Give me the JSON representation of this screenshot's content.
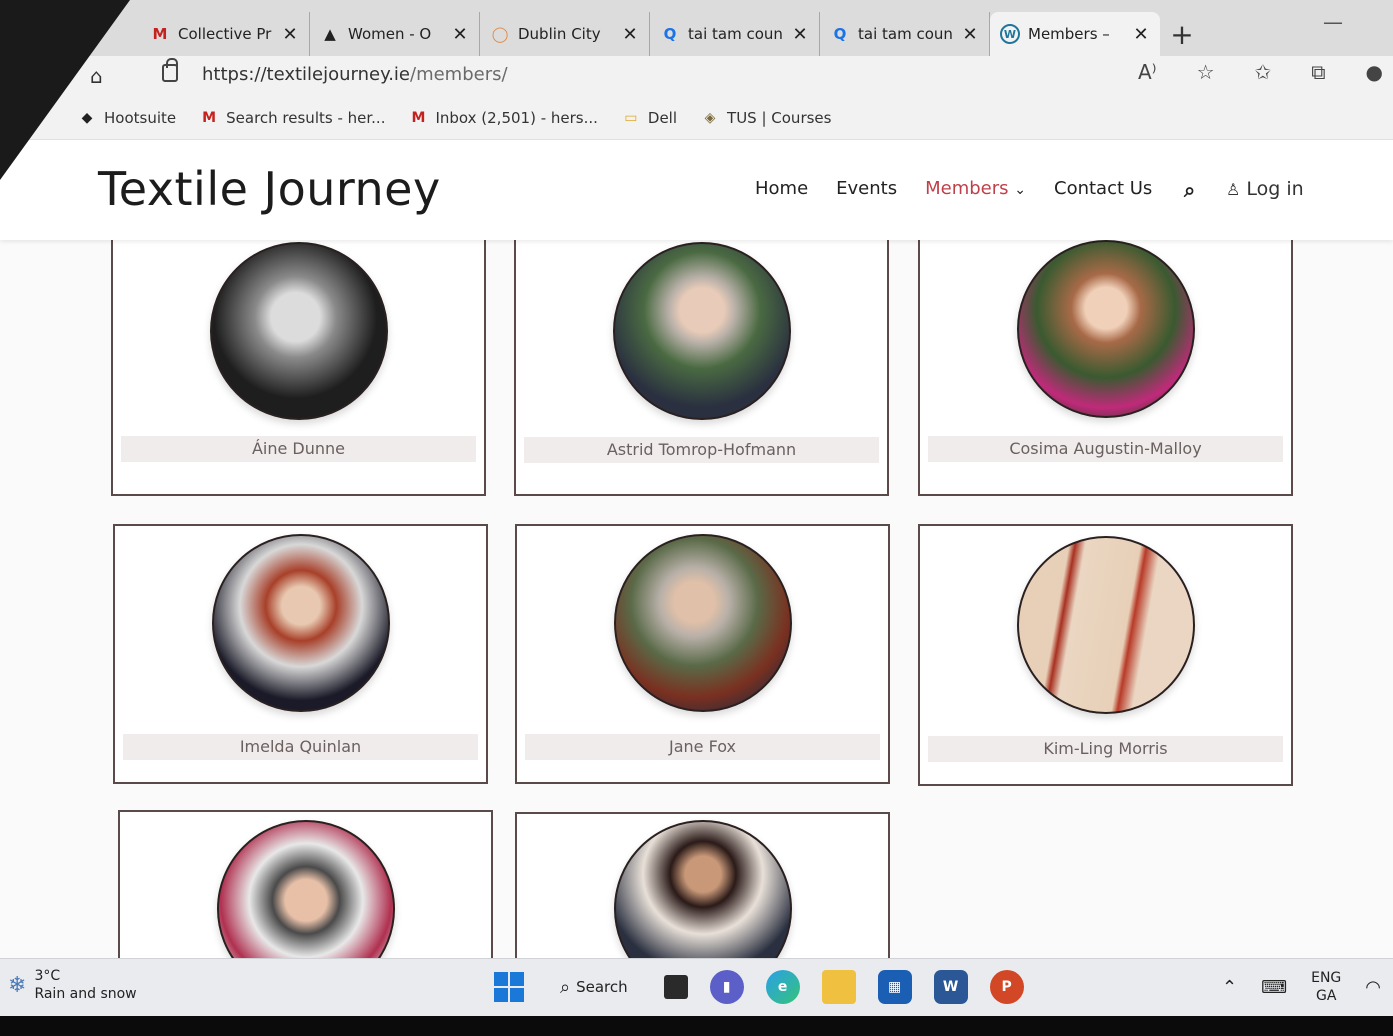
{
  "browser": {
    "tabs": [
      {
        "title": "Collective Pr",
        "icon": "M",
        "icon_color": "#c5221f",
        "active": false
      },
      {
        "title": "Women - O",
        "icon": "▲",
        "icon_color": "#222222",
        "active": false
      },
      {
        "title": "Dublin City",
        "icon": "◯",
        "icon_color": "#e08a4a",
        "active": false
      },
      {
        "title": "tai tam coun",
        "icon": "Q",
        "icon_color": "#1a73e8",
        "active": false
      },
      {
        "title": "tai tam coun",
        "icon": "Q",
        "icon_color": "#1a73e8",
        "active": false
      },
      {
        "title": "Members –",
        "icon": "W",
        "icon_color": "#21759b",
        "active": true
      }
    ],
    "new_tab": "+",
    "tab_close": "✕",
    "url_host": "https://textilejourney.ie",
    "url_path": "/members/",
    "read_aloud": "A⁾",
    "bookmarks": [
      {
        "label": "Hootsuite",
        "icon": "◆",
        "icon_color": "#222222"
      },
      {
        "label": "Search results - her...",
        "icon": "M",
        "icon_color": "#c5221f"
      },
      {
        "label": "Inbox (2,501) - hers...",
        "icon": "M",
        "icon_color": "#c5221f"
      },
      {
        "label": "Dell",
        "icon": "▭",
        "icon_color": "#e0a82a"
      },
      {
        "label": "TUS | Courses",
        "icon": "◈",
        "icon_color": "#7a6a3a"
      }
    ]
  },
  "site": {
    "title": "Textile Journey",
    "nav": {
      "home": "Home",
      "events": "Events",
      "members": "Members",
      "members_caret": "⌄",
      "contact": "Contact Us",
      "login": "Log in"
    },
    "accent_color": "#c0404a"
  },
  "members": [
    {
      "name": "Áine Dunne"
    },
    {
      "name": "Astrid Tomrop-Hofmann"
    },
    {
      "name": "Cosima Augustin-Malloy"
    },
    {
      "name": "Imelda Quinlan"
    },
    {
      "name": "Jane Fox"
    },
    {
      "name": "Kim-Ling Morris"
    }
  ],
  "taskbar": {
    "temperature": "3°C",
    "weather": "Rain and snow",
    "search_label": "Search",
    "lang_top": "ENG",
    "lang_bottom": "GA"
  }
}
